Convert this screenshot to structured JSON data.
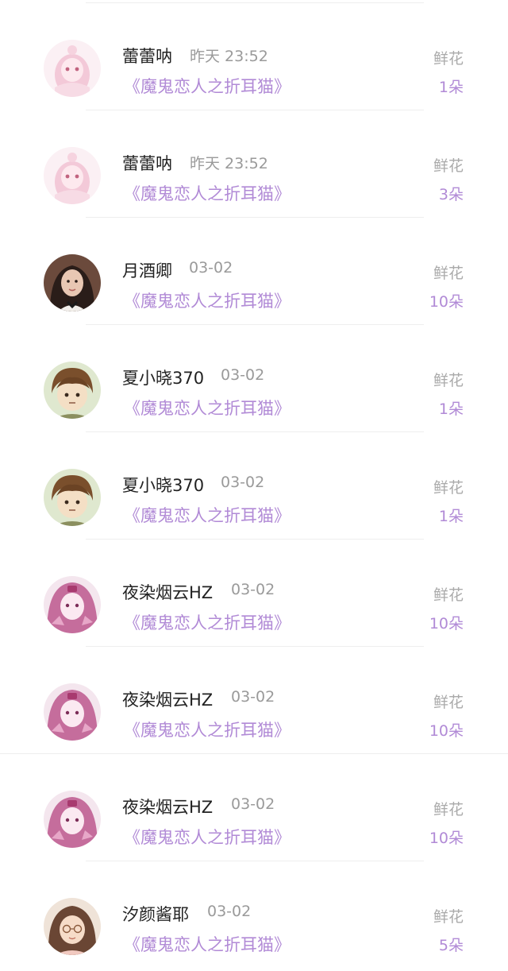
{
  "flower_records": [
    {
      "user": "蕾蕾呐",
      "time": "昨天 23:52",
      "book": "《魔鬼恋人之折耳猫》",
      "gift": "鲜花",
      "count": "1朵",
      "avatar": "pink-anime-girl-avatar"
    },
    {
      "user": "蕾蕾呐",
      "time": "昨天 23:52",
      "book": "《魔鬼恋人之折耳猫》",
      "gift": "鲜花",
      "count": "3朵",
      "avatar": "pink-anime-girl-avatar"
    },
    {
      "user": "月酒卿",
      "time": "03-02",
      "book": "《魔鬼恋人之折耳猫》",
      "gift": "鲜花",
      "count": "10朵",
      "avatar": "woman-photo-avatar"
    },
    {
      "user": "夏小晓370",
      "time": "03-02",
      "book": "《魔鬼恋人之折耳猫》",
      "gift": "鲜花",
      "count": "1朵",
      "avatar": "brown-hair-boy-avatar"
    },
    {
      "user": "夏小晓370",
      "time": "03-02",
      "book": "《魔鬼恋人之折耳猫》",
      "gift": "鲜花",
      "count": "1朵",
      "avatar": "brown-hair-boy-avatar"
    },
    {
      "user": "夜染烟云HZ",
      "time": "03-02",
      "book": "《魔鬼恋人之折耳猫》",
      "gift": "鲜花",
      "count": "10朵",
      "avatar": "magenta-anime-girl-avatar"
    },
    {
      "user": "夜染烟云HZ",
      "time": "03-02",
      "book": "《魔鬼恋人之折耳猫》",
      "gift": "鲜花",
      "count": "10朵",
      "avatar": "magenta-anime-girl-avatar"
    },
    {
      "user": "夜染烟云HZ",
      "time": "03-02",
      "book": "《魔鬼恋人之折耳猫》",
      "gift": "鲜花",
      "count": "10朵",
      "avatar": "magenta-anime-girl-avatar"
    },
    {
      "user": "汐颜酱耶",
      "time": "03-02",
      "book": "《魔鬼恋人之折耳猫》",
      "gift": "鲜花",
      "count": "5朵",
      "avatar": "glasses-girl-avatar"
    }
  ],
  "colors": {
    "accent": "#b18ad6",
    "name_text": "#222222",
    "meta_text": "#9a9a9a",
    "divider": "#eeeeee"
  }
}
